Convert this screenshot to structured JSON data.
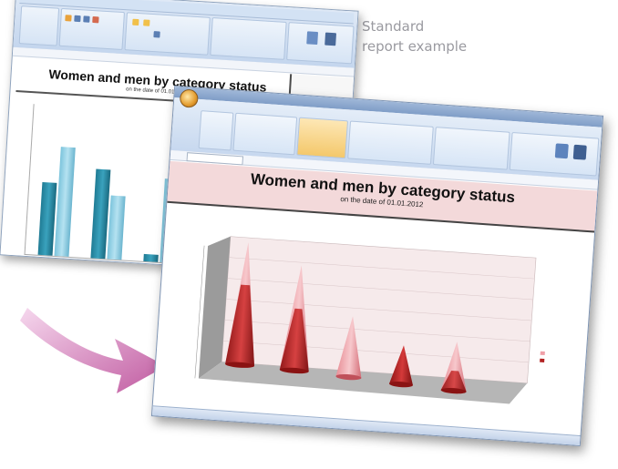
{
  "caption": {
    "line1": "Standard",
    "line2": "report example"
  },
  "back_report": {
    "title": "Women and men by category status",
    "subtitle": "on the date of 01.01.2012"
  },
  "front_report": {
    "title": "Women and men by category status",
    "subtitle": "on the date of 01.01.2012"
  },
  "colors": {
    "arrow": "#c05aa0",
    "banner": "#f3d9da",
    "bar_dark": "#2a8aa5",
    "bar_light": "#9fd3e6",
    "cone_dark": "#b22222",
    "cone_light": "#f0a0a8"
  }
}
